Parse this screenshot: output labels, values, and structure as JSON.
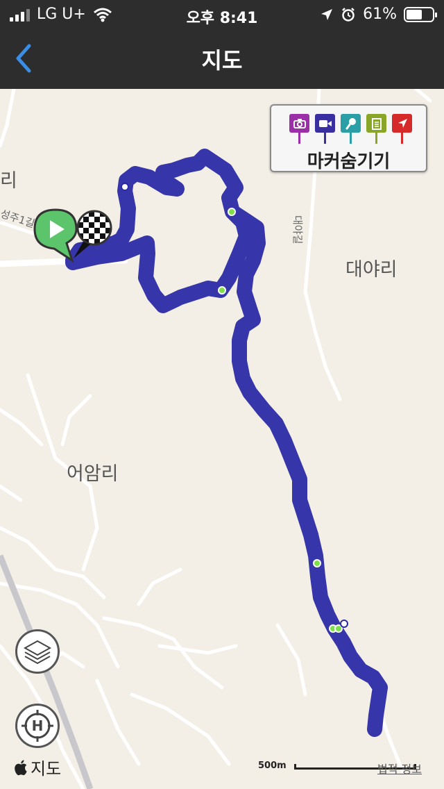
{
  "status_bar": {
    "carrier": "LG U+",
    "time": "오후 8:41",
    "battery": "61%",
    "battery_level": 0.61
  },
  "nav": {
    "title": "지도",
    "back_icon": "chevron-left-icon"
  },
  "map": {
    "places": [
      "리",
      "대야리",
      "어암리"
    ],
    "roads": [
      "성주1길",
      "대야길"
    ],
    "track_color": "#2b2aa6",
    "waypoint_color": "#7be04a",
    "start_color": "#5cc46a"
  },
  "marker_panel": {
    "label": "마커숨기기",
    "pins": [
      {
        "icon": "camera-icon",
        "color": "#9b2fa8"
      },
      {
        "icon": "video-icon",
        "color": "#3a2fa0"
      },
      {
        "icon": "microphone-icon",
        "color": "#2b9ea6"
      },
      {
        "icon": "note-icon",
        "color": "#8aa628"
      },
      {
        "icon": "navigation-arrow-icon",
        "color": "#d62a2a"
      }
    ]
  },
  "controls": {
    "layers_icon": "layers-icon",
    "home_icon": "home-crosshair-icon"
  },
  "footer": {
    "brand": "지도",
    "scale": "500m",
    "legal": "법적 정보"
  }
}
